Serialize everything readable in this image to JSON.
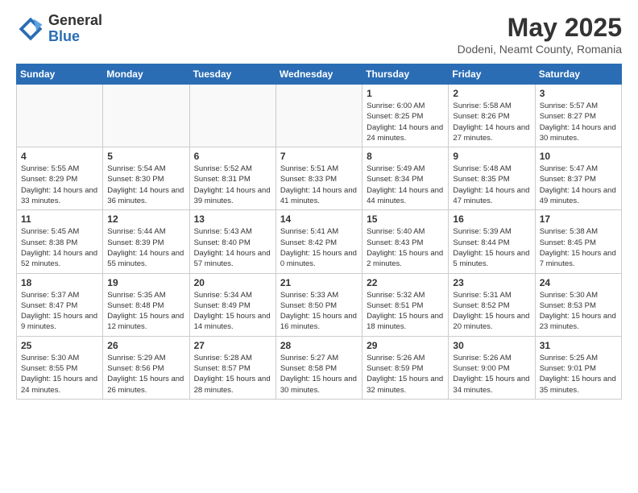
{
  "header": {
    "logo_general": "General",
    "logo_blue": "Blue",
    "title": "May 2025",
    "subtitle": "Dodeni, Neamt County, Romania"
  },
  "weekdays": [
    "Sunday",
    "Monday",
    "Tuesday",
    "Wednesday",
    "Thursday",
    "Friday",
    "Saturday"
  ],
  "weeks": [
    [
      {
        "day": "",
        "info": ""
      },
      {
        "day": "",
        "info": ""
      },
      {
        "day": "",
        "info": ""
      },
      {
        "day": "",
        "info": ""
      },
      {
        "day": "1",
        "info": "Sunrise: 6:00 AM\nSunset: 8:25 PM\nDaylight: 14 hours\nand 24 minutes."
      },
      {
        "day": "2",
        "info": "Sunrise: 5:58 AM\nSunset: 8:26 PM\nDaylight: 14 hours\nand 27 minutes."
      },
      {
        "day": "3",
        "info": "Sunrise: 5:57 AM\nSunset: 8:27 PM\nDaylight: 14 hours\nand 30 minutes."
      }
    ],
    [
      {
        "day": "4",
        "info": "Sunrise: 5:55 AM\nSunset: 8:29 PM\nDaylight: 14 hours\nand 33 minutes."
      },
      {
        "day": "5",
        "info": "Sunrise: 5:54 AM\nSunset: 8:30 PM\nDaylight: 14 hours\nand 36 minutes."
      },
      {
        "day": "6",
        "info": "Sunrise: 5:52 AM\nSunset: 8:31 PM\nDaylight: 14 hours\nand 39 minutes."
      },
      {
        "day": "7",
        "info": "Sunrise: 5:51 AM\nSunset: 8:33 PM\nDaylight: 14 hours\nand 41 minutes."
      },
      {
        "day": "8",
        "info": "Sunrise: 5:49 AM\nSunset: 8:34 PM\nDaylight: 14 hours\nand 44 minutes."
      },
      {
        "day": "9",
        "info": "Sunrise: 5:48 AM\nSunset: 8:35 PM\nDaylight: 14 hours\nand 47 minutes."
      },
      {
        "day": "10",
        "info": "Sunrise: 5:47 AM\nSunset: 8:37 PM\nDaylight: 14 hours\nand 49 minutes."
      }
    ],
    [
      {
        "day": "11",
        "info": "Sunrise: 5:45 AM\nSunset: 8:38 PM\nDaylight: 14 hours\nand 52 minutes."
      },
      {
        "day": "12",
        "info": "Sunrise: 5:44 AM\nSunset: 8:39 PM\nDaylight: 14 hours\nand 55 minutes."
      },
      {
        "day": "13",
        "info": "Sunrise: 5:43 AM\nSunset: 8:40 PM\nDaylight: 14 hours\nand 57 minutes."
      },
      {
        "day": "14",
        "info": "Sunrise: 5:41 AM\nSunset: 8:42 PM\nDaylight: 15 hours\nand 0 minutes."
      },
      {
        "day": "15",
        "info": "Sunrise: 5:40 AM\nSunset: 8:43 PM\nDaylight: 15 hours\nand 2 minutes."
      },
      {
        "day": "16",
        "info": "Sunrise: 5:39 AM\nSunset: 8:44 PM\nDaylight: 15 hours\nand 5 minutes."
      },
      {
        "day": "17",
        "info": "Sunrise: 5:38 AM\nSunset: 8:45 PM\nDaylight: 15 hours\nand 7 minutes."
      }
    ],
    [
      {
        "day": "18",
        "info": "Sunrise: 5:37 AM\nSunset: 8:47 PM\nDaylight: 15 hours\nand 9 minutes."
      },
      {
        "day": "19",
        "info": "Sunrise: 5:35 AM\nSunset: 8:48 PM\nDaylight: 15 hours\nand 12 minutes."
      },
      {
        "day": "20",
        "info": "Sunrise: 5:34 AM\nSunset: 8:49 PM\nDaylight: 15 hours\nand 14 minutes."
      },
      {
        "day": "21",
        "info": "Sunrise: 5:33 AM\nSunset: 8:50 PM\nDaylight: 15 hours\nand 16 minutes."
      },
      {
        "day": "22",
        "info": "Sunrise: 5:32 AM\nSunset: 8:51 PM\nDaylight: 15 hours\nand 18 minutes."
      },
      {
        "day": "23",
        "info": "Sunrise: 5:31 AM\nSunset: 8:52 PM\nDaylight: 15 hours\nand 20 minutes."
      },
      {
        "day": "24",
        "info": "Sunrise: 5:30 AM\nSunset: 8:53 PM\nDaylight: 15 hours\nand 23 minutes."
      }
    ],
    [
      {
        "day": "25",
        "info": "Sunrise: 5:30 AM\nSunset: 8:55 PM\nDaylight: 15 hours\nand 24 minutes."
      },
      {
        "day": "26",
        "info": "Sunrise: 5:29 AM\nSunset: 8:56 PM\nDaylight: 15 hours\nand 26 minutes."
      },
      {
        "day": "27",
        "info": "Sunrise: 5:28 AM\nSunset: 8:57 PM\nDaylight: 15 hours\nand 28 minutes."
      },
      {
        "day": "28",
        "info": "Sunrise: 5:27 AM\nSunset: 8:58 PM\nDaylight: 15 hours\nand 30 minutes."
      },
      {
        "day": "29",
        "info": "Sunrise: 5:26 AM\nSunset: 8:59 PM\nDaylight: 15 hours\nand 32 minutes."
      },
      {
        "day": "30",
        "info": "Sunrise: 5:26 AM\nSunset: 9:00 PM\nDaylight: 15 hours\nand 34 minutes."
      },
      {
        "day": "31",
        "info": "Sunrise: 5:25 AM\nSunset: 9:01 PM\nDaylight: 15 hours\nand 35 minutes."
      }
    ]
  ]
}
